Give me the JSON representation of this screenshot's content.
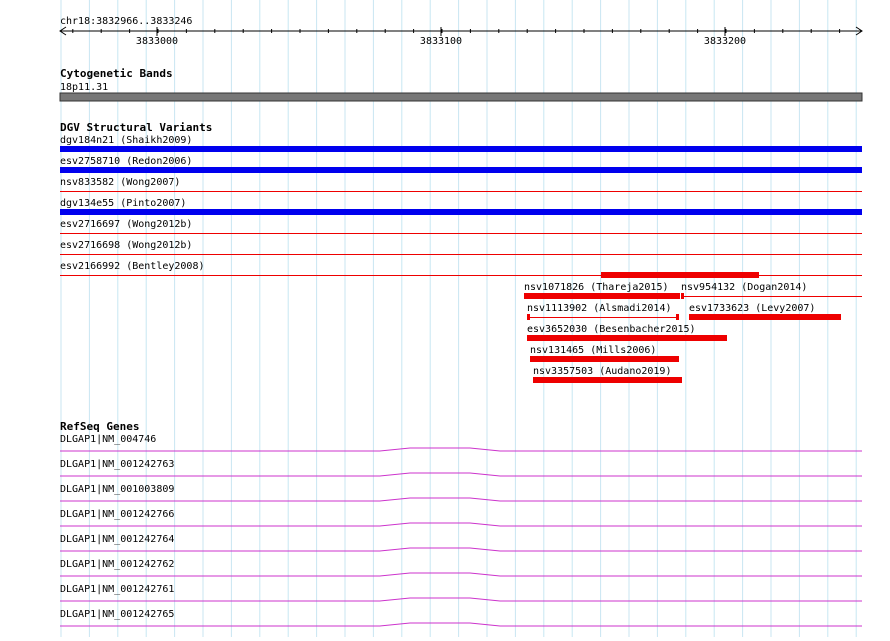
{
  "ruler": {
    "region": "chr18:3832966..3833246",
    "ticks": [
      "3833000",
      "3833100",
      "3833200"
    ]
  },
  "cytoband": {
    "title": "Cytogenetic Bands",
    "band": "18p11.31",
    "color": "#777777"
  },
  "dgv": {
    "title": "DGV Structural Variants",
    "gain_color": "#0000ee",
    "loss_color": "#ee0000",
    "full_rows": [
      {
        "label": "dgv184n21 (Shaikh2009)",
        "kind": "gain"
      },
      {
        "label": "esv2758710 (Redon2006)",
        "kind": "gain"
      },
      {
        "label": "nsv833582 (Wong2007)",
        "kind": "thin"
      },
      {
        "label": "dgv134e55 (Pinto2007)",
        "kind": "gain"
      },
      {
        "label": "esv2716697 (Wong2012b)",
        "kind": "thin"
      },
      {
        "label": "esv2716698 (Wong2012b)",
        "kind": "thin"
      },
      {
        "label": "esv2166992 (Bentley2008)",
        "kind": "thin"
      }
    ],
    "loss_items": [
      {
        "label": "nsv1071826 (Thareja2015)"
      },
      {
        "label": "nsv954132 (Dogan2014)"
      },
      {
        "label": "nsv1113902 (Alsmadi2014)"
      },
      {
        "label": "esv1733623 (Levy2007)"
      },
      {
        "label": "esv3652030 (Besenbacher2015)"
      },
      {
        "label": "nsv131465 (Mills2006)"
      },
      {
        "label": "nsv3357503 (Audano2019)"
      }
    ]
  },
  "refseq": {
    "title": "RefSeq Genes",
    "color": "#cc33cc",
    "genes": [
      "DLGAP1|NM_004746",
      "DLGAP1|NM_001242763",
      "DLGAP1|NM_001003809",
      "DLGAP1|NM_001242766",
      "DLGAP1|NM_001242764",
      "DLGAP1|NM_001242762",
      "DLGAP1|NM_001242761",
      "DLGAP1|NM_001242765"
    ]
  }
}
